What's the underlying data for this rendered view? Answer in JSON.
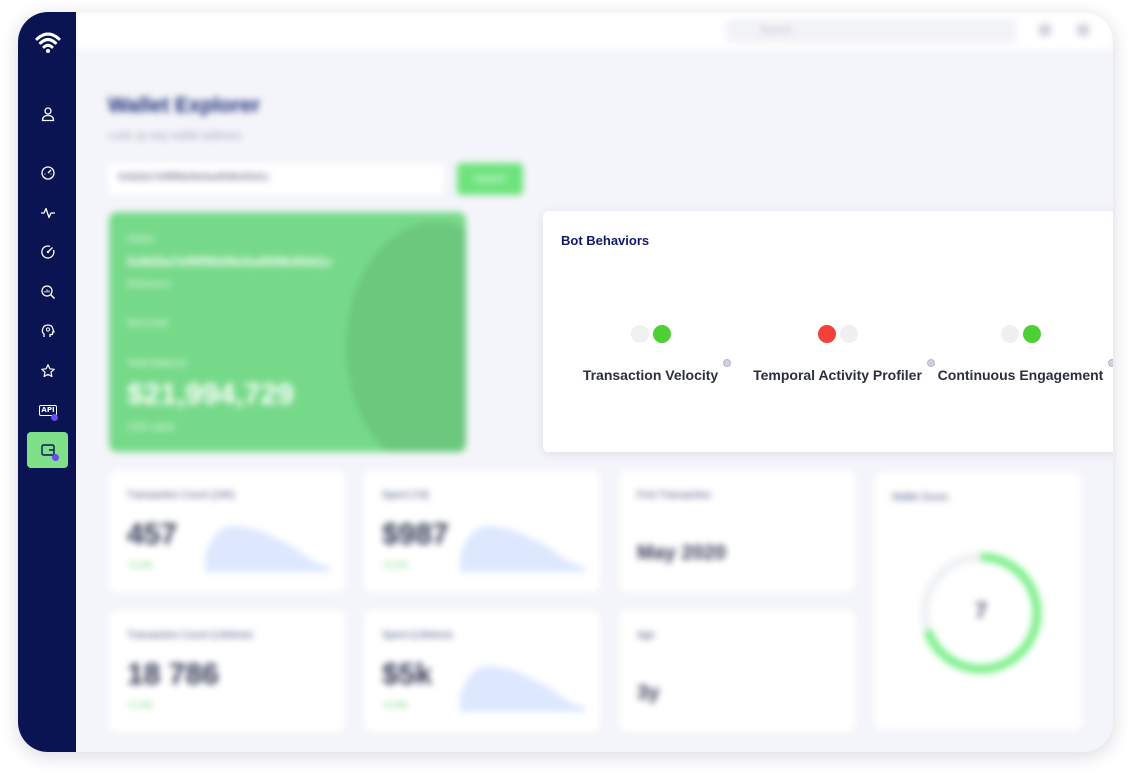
{
  "sidebar": {
    "items": [
      {
        "icon": "user-icon"
      },
      {
        "icon": "speedometer-icon"
      },
      {
        "icon": "pulse-icon"
      },
      {
        "icon": "analytics-dial-icon"
      },
      {
        "icon": "search-chart-icon"
      },
      {
        "icon": "brain-head-icon"
      },
      {
        "icon": "star-icon"
      },
      {
        "icon": "api-icon",
        "label": "API"
      },
      {
        "icon": "wallet-box-icon",
        "active": true
      }
    ],
    "accent": "#7ee089",
    "background": "#0b1452"
  },
  "topbar": {
    "search_placeholder": "Search"
  },
  "page": {
    "title": "Wallet Explorer",
    "subtitle": "Look up any wallet address"
  },
  "address_search": {
    "value": "0x8d3a7ef9ff9b09e5a4f09b4f4d1c",
    "button_label": "Search"
  },
  "wallet_card": {
    "label": "Wallet",
    "address": "0x8d3a7ef9ff9b09e5a4f09b4f4d1c",
    "network": "Ethereum",
    "tag": "Not a bot",
    "balance_label": "Total Balance",
    "balance": "$21,994,729",
    "currency": "USD value"
  },
  "bot_behaviors": {
    "title": "Bot Behaviors",
    "items": [
      {
        "label": "Transaction Velocity",
        "state": "green"
      },
      {
        "label": "Temporal Activity Profiler",
        "state": "red"
      },
      {
        "label": "Continuous Engagement",
        "state": "green"
      }
    ]
  },
  "stats": {
    "tx_count": {
      "title": "Transaction Count (24h)",
      "value": "457",
      "delta": "+3.2%"
    },
    "spent": {
      "title": "Spent (7d)",
      "value": "$987",
      "delta": "+2.1%"
    },
    "first_tx": {
      "title": "First Transaction",
      "value": "May 2020"
    },
    "tx_count_lifetime": {
      "title": "Transaction Count (Lifetime)",
      "value": "18 786",
      "delta": "+1.4%"
    },
    "spent_lifetime": {
      "title": "Spent (Lifetime)",
      "value": "$5k",
      "delta": "+0.9%"
    },
    "age": {
      "title": "Age",
      "value": "3y"
    },
    "wallet_score": {
      "title": "Wallet Score",
      "value": "7"
    }
  }
}
